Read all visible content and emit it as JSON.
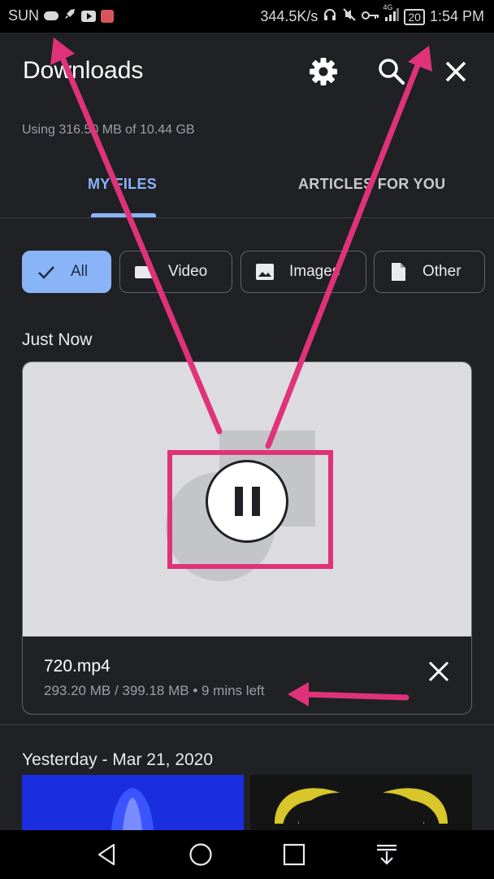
{
  "status_bar": {
    "carrier": "SUN",
    "speed": "344.5K/s",
    "network": "4G",
    "battery": "20",
    "time": "1:54 PM"
  },
  "app": {
    "title": "Downloads",
    "storage_usage": "Using 316.50 MB of 10.44 GB"
  },
  "tabs": [
    {
      "label": "MY FILES",
      "selected": true
    },
    {
      "label": "ARTICLES FOR YOU",
      "selected": false
    }
  ],
  "filters": [
    {
      "label": "All",
      "icon": "check-icon",
      "selected": true
    },
    {
      "label": "Video",
      "icon": "video-icon",
      "selected": false
    },
    {
      "label": "Images",
      "icon": "image-icon",
      "selected": false
    },
    {
      "label": "Other",
      "icon": "file-icon",
      "selected": false
    }
  ],
  "sections": {
    "just_now": "Just Now",
    "yesterday": "Yesterday - Mar 21, 2020"
  },
  "download": {
    "filename": "720.mp4",
    "progress_text": "293.20 MB / 399.18 MB • 9 mins left",
    "progress_fraction": 0.73,
    "state": "downloading"
  },
  "colors": {
    "accent": "#8ab4f8",
    "background": "#202124",
    "annotation": "#e0327a"
  }
}
